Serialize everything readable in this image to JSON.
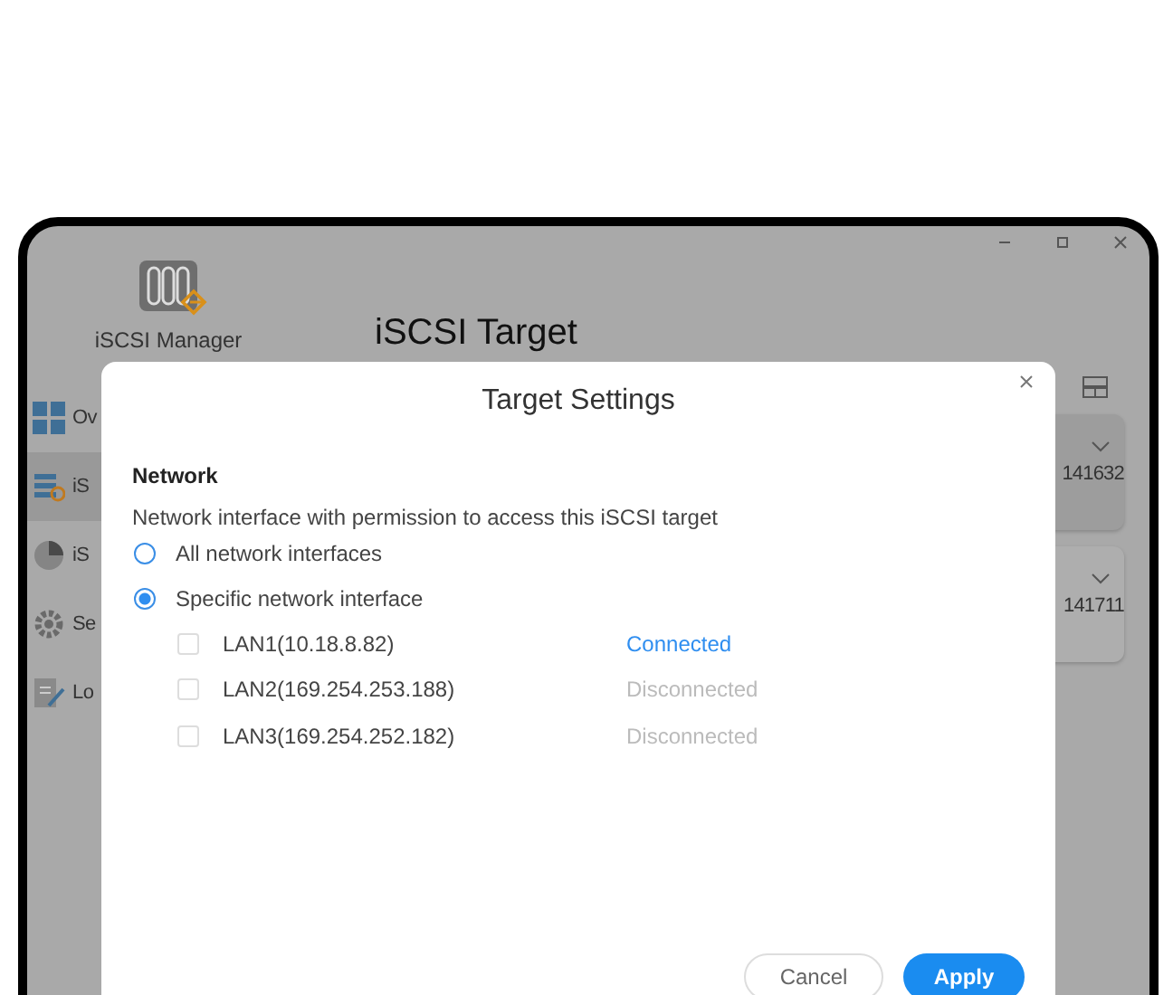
{
  "window": {
    "app_name": "iSCSI Manager",
    "title": "iSCSI Target"
  },
  "sidebar": {
    "items": [
      {
        "label": "Ov",
        "kind": "overview",
        "selected": false
      },
      {
        "label": "iS",
        "kind": "target",
        "selected": true
      },
      {
        "label": "iS",
        "kind": "lun",
        "selected": false
      },
      {
        "label": "Se",
        "kind": "settings",
        "selected": false
      },
      {
        "label": "Lo",
        "kind": "log",
        "selected": false
      }
    ]
  },
  "cards": [
    {
      "value": "141632",
      "selected": true
    },
    {
      "value": "141711",
      "selected": false
    }
  ],
  "dialog": {
    "title": "Target Settings",
    "section": "Network",
    "description": "Network interface with permission to access this iSCSI target",
    "options": [
      {
        "label": "All network interfaces",
        "selected": false
      },
      {
        "label": "Specific network interface",
        "selected": true
      }
    ],
    "interfaces": [
      {
        "label": "LAN1(10.18.8.82)",
        "checked": false,
        "status": "Connected",
        "kind": "connected"
      },
      {
        "label": "LAN2(169.254.253.188)",
        "checked": false,
        "status": "Disconnected",
        "kind": "disconnected"
      },
      {
        "label": "LAN3(169.254.252.182)",
        "checked": false,
        "status": "Disconnected",
        "kind": "disconnected"
      }
    ],
    "buttons": [
      {
        "label": "Cancel",
        "kind": "secondary"
      },
      {
        "label": "Apply",
        "kind": "primary"
      }
    ]
  }
}
